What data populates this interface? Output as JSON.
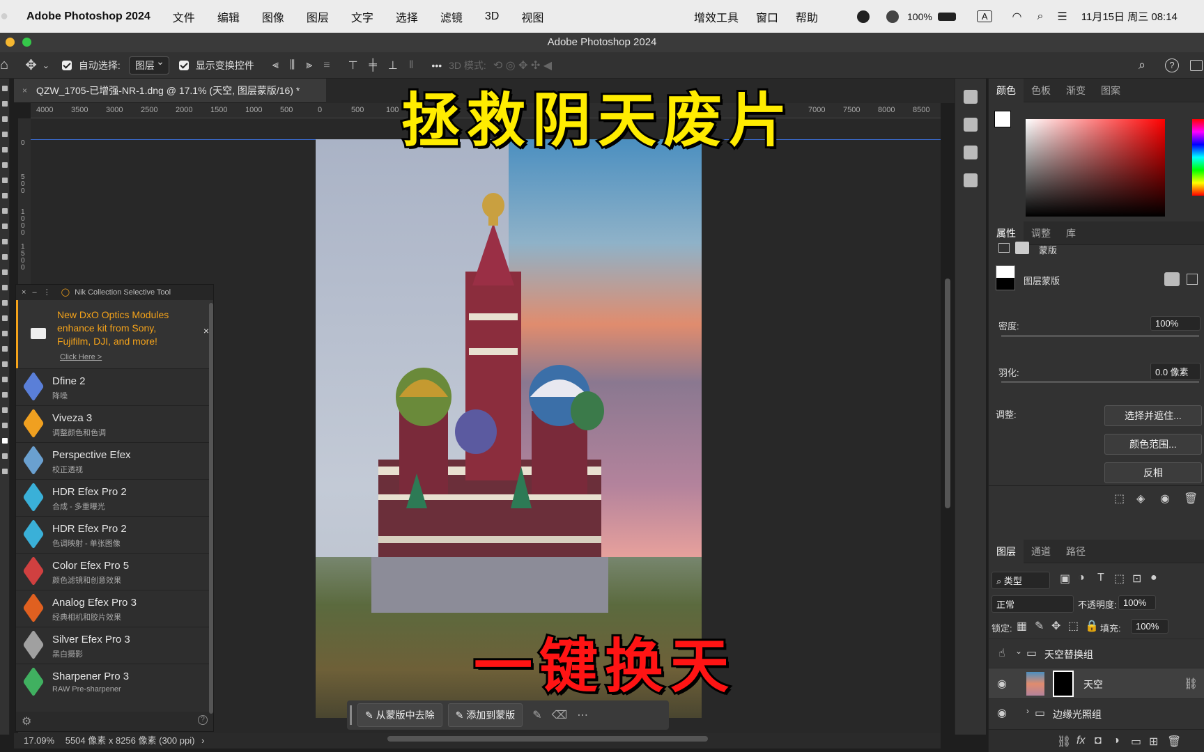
{
  "menubar": {
    "app": "Adobe Photoshop 2024",
    "items": [
      "文件",
      "编辑",
      "图像",
      "图层",
      "文字",
      "选择",
      "滤镜",
      "3D",
      "视图",
      "增效工具",
      "窗口",
      "帮助"
    ],
    "battery": "100%",
    "input": "A",
    "datetime": "11月15日 周三  08:14"
  },
  "window": {
    "title": "Adobe Photoshop 2024"
  },
  "options": {
    "auto_select_label": "自动选择:",
    "auto_select_value": "图层",
    "show_transform_label": "显示变换控件",
    "more": "•••",
    "mode_3d": "3D 模式:"
  },
  "document": {
    "tab_title": "QZW_1705-已增强-NR-1.dng @ 17.1% (天空, 图层蒙版/16) *",
    "ruler_ticks": [
      "4000",
      "3500",
      "3000",
      "2500",
      "2000",
      "1500",
      "1000",
      "500",
      "0",
      "500",
      "100",
      "7000",
      "7500",
      "8000",
      "8500"
    ],
    "vruler_ticks": [
      "0",
      "500",
      "1000",
      "1500"
    ]
  },
  "captions": {
    "top": "拯救阴天废片",
    "bottom": "一键换天"
  },
  "nik": {
    "title": "Nik Collection Selective Tool",
    "ad": {
      "text": "New DxO Optics Modules enhance kit from Sony, Fujifilm, DJI, and more!",
      "link": "Click Here >"
    },
    "items": [
      {
        "name": "Dfine 2",
        "sub": "降噪",
        "color": "#5a7fd8"
      },
      {
        "name": "Viveza 3",
        "sub": "调整颜色和色调",
        "color": "#f0a020"
      },
      {
        "name": "Perspective Efex",
        "sub": "校正透视",
        "color": "#6aa0d0"
      },
      {
        "name": "HDR Efex Pro 2",
        "sub": "合成 - 多重曝光",
        "color": "#3ab0d8"
      },
      {
        "name": "HDR Efex Pro 2",
        "sub": "色调映射 - 单张图像",
        "color": "#3ab0d8"
      },
      {
        "name": "Color Efex Pro 5",
        "sub": "颜色滤镜和创意效果",
        "color": "#d04040"
      },
      {
        "name": "Analog Efex Pro 3",
        "sub": "经典相机和胶片效果",
        "color": "#e06020"
      },
      {
        "name": "Silver Efex Pro 3",
        "sub": "黑白摄影",
        "color": "#a0a0a0"
      },
      {
        "name": "Sharpener Pro 3",
        "sub": "RAW Pre-sharpener",
        "color": "#40b060"
      }
    ]
  },
  "maskbar": {
    "remove": "从蒙版中去除",
    "add": "添加到蒙版"
  },
  "status": {
    "zoom": "17.09%",
    "info": "5504 像素 x 8256 像素 (300 ppi)"
  },
  "color_panel": {
    "tabs": [
      "颜色",
      "色板",
      "渐变",
      "图案"
    ]
  },
  "properties": {
    "tabs": [
      "属性",
      "调整",
      "库"
    ],
    "section": "蒙版",
    "layer_mask": "图层蒙版",
    "density_label": "密度:",
    "density_value": "100%",
    "feather_label": "羽化:",
    "feather_value": "0.0 像素",
    "adjust_label": "调整:",
    "buttons": [
      "选择并遮住...",
      "颜色范围...",
      "反相"
    ]
  },
  "layers": {
    "tabs": [
      "图层",
      "通道",
      "路径"
    ],
    "filter": "类型",
    "blend": "正常",
    "opacity_label": "不透明度:",
    "opacity_value": "100%",
    "lock_label": "锁定:",
    "fill_label": "填充:",
    "fill_value": "100%",
    "rows": [
      {
        "name": "天空替换组",
        "type": "group"
      },
      {
        "name": "天空",
        "type": "layer"
      },
      {
        "name": "边缘光照组",
        "type": "group"
      }
    ]
  }
}
